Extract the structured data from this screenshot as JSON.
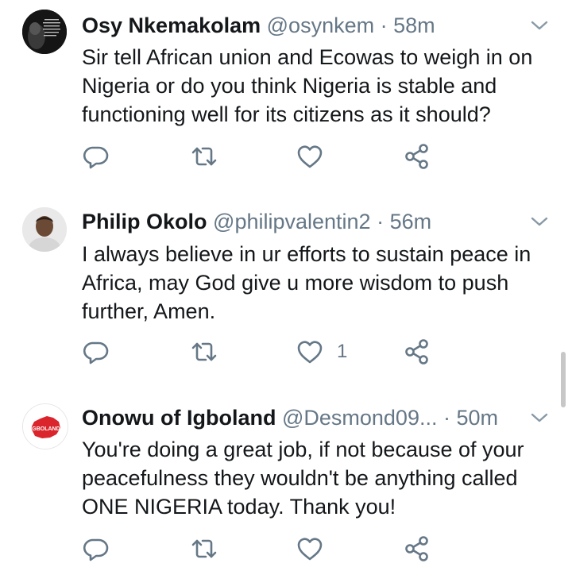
{
  "tweets": [
    {
      "name": "Osy Nkemakolam",
      "handle": "@osynkem",
      "separator": "·",
      "time": "58m",
      "lines": [
        "Sir tell African union and Ecowas to weigh in on",
        "Nigeria or do you think Nigeria is stable and",
        "functioning well for its citizens as it should?"
      ],
      "like_count": ""
    },
    {
      "name": "Philip Okolo",
      "handle": "@philipvalentin2",
      "separator": "·",
      "time": "56m",
      "lines": [
        "I always believe in ur efforts to sustain peace in",
        "Africa, may God give u more wisdom to push",
        "further, Amen."
      ],
      "like_count": "1"
    },
    {
      "name": "Onowu of Igboland",
      "handle": "@Desmond09...",
      "separator": "·",
      "time": "50m",
      "lines": [
        "You're doing a great job, if not because of your",
        "peacefulness they wouldn't be anything called",
        "ONE NIGERIA today. Thank you!"
      ],
      "like_count": "",
      "avatar_text": "IGBOLAND"
    }
  ],
  "icons": {
    "reply": "reply-icon",
    "retweet": "retweet-icon",
    "like": "heart-icon",
    "share": "share-icon",
    "menu": "chevron-down-icon"
  },
  "colors": {
    "text": "#14171a",
    "secondary": "#657786",
    "igboland_red": "#d9252b"
  }
}
